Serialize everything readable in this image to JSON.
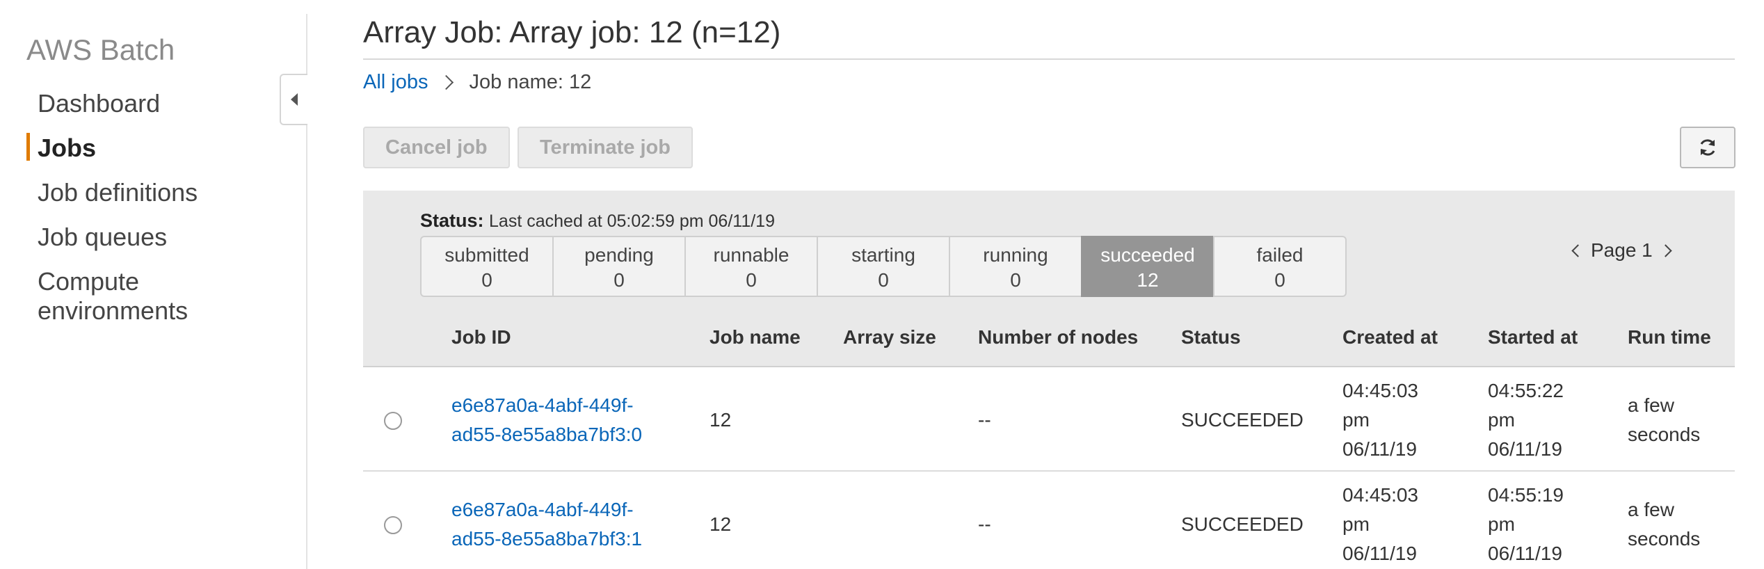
{
  "sidebar": {
    "title": "AWS Batch",
    "items": [
      {
        "label": "Dashboard"
      },
      {
        "label": "Jobs"
      },
      {
        "label": "Job definitions"
      },
      {
        "label": "Job queues"
      },
      {
        "label": "Compute"
      },
      {
        "label": "environments"
      }
    ]
  },
  "header": {
    "title": "Array Job: Array job: 12 (n=12)",
    "breadcrumb": {
      "link": "All jobs",
      "current": "Job name: 12"
    }
  },
  "toolbar": {
    "cancel_label": "Cancel job",
    "terminate_label": "Terminate job",
    "refresh_icon": "refresh-icon"
  },
  "status": {
    "label": "Status:",
    "cached": "Last cached at 05:02:59 pm 06/11/19",
    "tabs": [
      {
        "label": "submitted",
        "count": "0"
      },
      {
        "label": "pending",
        "count": "0"
      },
      {
        "label": "runnable",
        "count": "0"
      },
      {
        "label": "starting",
        "count": "0"
      },
      {
        "label": "running",
        "count": "0"
      },
      {
        "label": "succeeded",
        "count": "12"
      },
      {
        "label": "failed",
        "count": "0"
      }
    ],
    "selected_tab": "succeeded"
  },
  "pager": {
    "label": "Page 1"
  },
  "table": {
    "columns": [
      "Job ID",
      "Job name",
      "Array size",
      "Number of nodes",
      "Status",
      "Created at",
      "Started at",
      "Run time"
    ],
    "rows": [
      {
        "job_id_1": "e6e87a0a-4abf-449f-",
        "job_id_2": "ad55-8e55a8ba7bf3:0",
        "job_name": "12",
        "array_size": "",
        "nodes": "--",
        "status": "SUCCEEDED",
        "created_1": "04:45:03",
        "created_2": "pm",
        "created_3": "06/11/19",
        "started_1": "04:55:22",
        "started_2": "pm",
        "started_3": "06/11/19",
        "runtime_1": "a few",
        "runtime_2": "seconds"
      },
      {
        "job_id_1": "e6e87a0a-4abf-449f-",
        "job_id_2": "ad55-8e55a8ba7bf3:1",
        "job_name": "12",
        "array_size": "",
        "nodes": "--",
        "status": "SUCCEEDED",
        "created_1": "04:45:03",
        "created_2": "pm",
        "created_3": "06/11/19",
        "started_1": "04:55:19",
        "started_2": "pm",
        "started_3": "06/11/19",
        "runtime_1": "a few",
        "runtime_2": "seconds"
      }
    ]
  }
}
